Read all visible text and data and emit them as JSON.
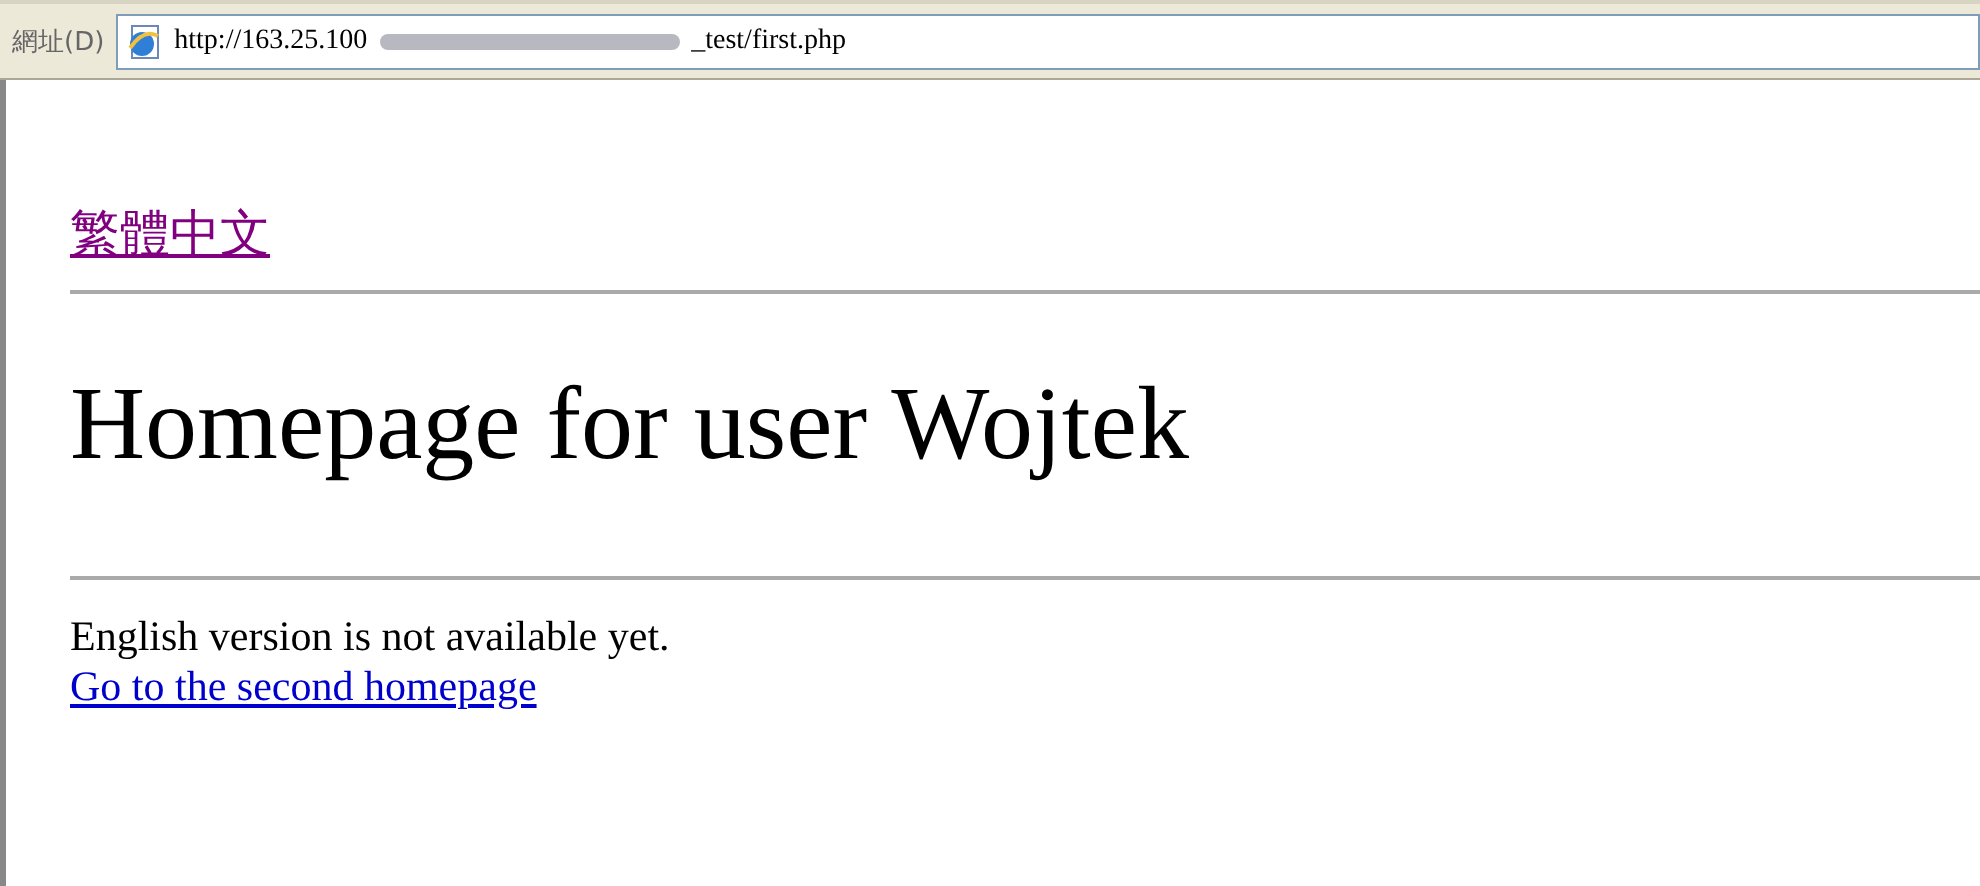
{
  "address_bar": {
    "label": "網址(D)",
    "url_start": "http://163.25.100",
    "url_end": "_test/first.php"
  },
  "page": {
    "language_link": "繁體中文",
    "heading": "Homepage for user Wojtek",
    "notice": "English version is not available yet.",
    "second_link": "Go to the second homepage"
  }
}
